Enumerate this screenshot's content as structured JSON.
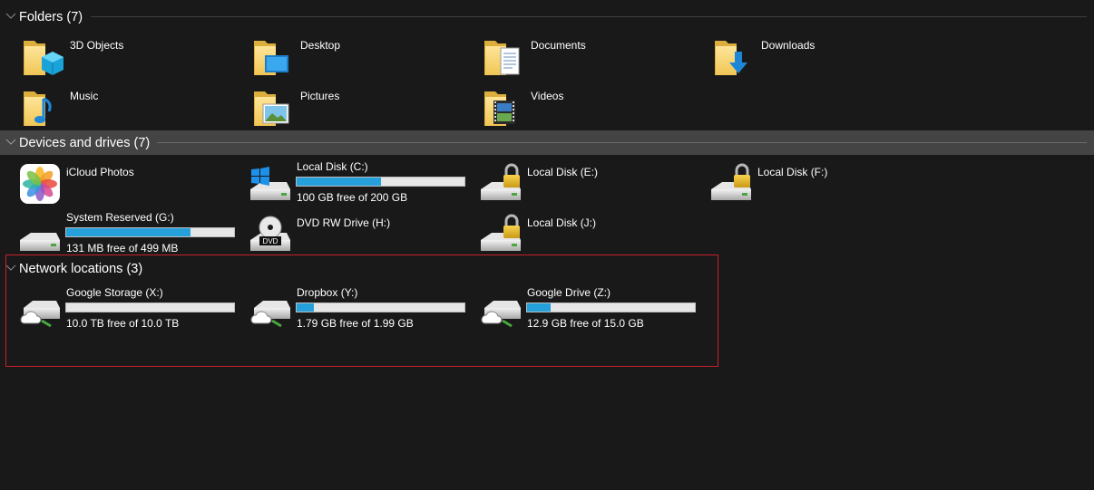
{
  "groups": {
    "folders": {
      "title": "Folders (7)"
    },
    "devices": {
      "title": "Devices and drives (7)"
    },
    "network": {
      "title": "Network locations (3)"
    }
  },
  "folders": [
    {
      "name": "3D Objects",
      "icon": "folder-3d-objects-icon"
    },
    {
      "name": "Desktop",
      "icon": "folder-desktop-icon"
    },
    {
      "name": "Documents",
      "icon": "folder-documents-icon"
    },
    {
      "name": "Downloads",
      "icon": "folder-downloads-icon"
    },
    {
      "name": "Music",
      "icon": "folder-music-icon"
    },
    {
      "name": "Pictures",
      "icon": "folder-pictures-icon"
    },
    {
      "name": "Videos",
      "icon": "folder-videos-icon"
    }
  ],
  "devices": [
    {
      "name": "iCloud Photos",
      "icon": "icloud-photos-icon"
    },
    {
      "name": "Local Disk (C:)",
      "free": "100 GB free of 200 GB",
      "used_fraction": 0.5,
      "icon": "windows-drive-icon"
    },
    {
      "name": "Local Disk (E:)",
      "icon": "locked-drive-icon"
    },
    {
      "name": "Local Disk (F:)",
      "icon": "locked-drive-icon"
    },
    {
      "name": "System Reserved (G:)",
      "free": "131 MB free of 499 MB",
      "used_fraction": 0.74,
      "icon": "drive-icon"
    },
    {
      "name": "DVD RW Drive (H:)",
      "icon": "dvd-drive-icon",
      "badge": "DVD"
    },
    {
      "name": "Local Disk (J:)",
      "icon": "locked-drive-icon"
    }
  ],
  "network": [
    {
      "name": "Google Storage (X:)",
      "free": "10.0 TB free of 10.0 TB",
      "used_fraction": 0.0,
      "icon": "network-drive-icon"
    },
    {
      "name": "Dropbox (Y:)",
      "free": "1.79 GB free of 1.99 GB",
      "used_fraction": 0.1,
      "icon": "network-drive-icon"
    },
    {
      "name": "Google Drive (Z:)",
      "free": "12.9 GB free of 15.0 GB",
      "used_fraction": 0.14,
      "icon": "network-drive-icon"
    }
  ],
  "colors": {
    "background": "#191919",
    "selected_header": "#444444",
    "bar_fill": "#26a0da",
    "bar_track": "#e6e6e6",
    "highlight_border": "#c8202a"
  }
}
